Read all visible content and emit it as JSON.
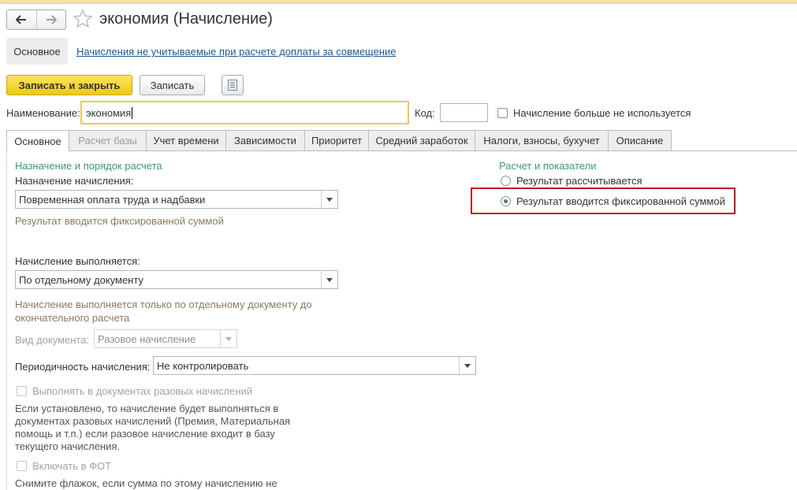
{
  "header": {
    "title": "экономия (Начисление)",
    "back_icon": "arrow-left-icon",
    "forward_icon": "arrow-right-icon",
    "favorite_icon": "star-icon"
  },
  "panel": {
    "main_label": "Основное",
    "link_text": "Начисления не учитываемые при расчете доплаты за совмещение"
  },
  "toolbar": {
    "save_close_label": "Записать и закрыть",
    "save_label": "Записать",
    "list_icon": "list-icon"
  },
  "form": {
    "name_label": "Наименование:",
    "name_value": "экономия",
    "code_label": "Код:",
    "code_value": "",
    "not_used_label": "Начисление больше не используется",
    "not_used_checked": false
  },
  "tabs": [
    {
      "label": "Основное",
      "state": "active"
    },
    {
      "label": "Расчет базы",
      "state": "disabled"
    },
    {
      "label": "Учет времени",
      "state": "normal"
    },
    {
      "label": "Зависимости",
      "state": "normal"
    },
    {
      "label": "Приоритет",
      "state": "normal"
    },
    {
      "label": "Средний заработок",
      "state": "normal"
    },
    {
      "label": "Налоги, взносы, бухучет",
      "state": "normal"
    },
    {
      "label": "Описание",
      "state": "normal"
    }
  ],
  "left": {
    "section_title": "Назначение и порядок расчета",
    "purpose_label": "Назначение начисления:",
    "purpose_value": "Повременная оплата труда и надбавки",
    "purpose_hint": "Результат вводится фиксированной суммой",
    "execution_label": "Начисление выполняется:",
    "execution_value": "По отдельному документу",
    "execution_hint": "Начисление выполняется только по отдельному документу до окончательного расчета",
    "doc_type_label": "Вид документа:",
    "doc_type_value": "Разовое начисление",
    "periodicity_label": "Периодичность начисления:",
    "periodicity_value": "Не контролировать",
    "one_time_label": "Выполнять в документах разовых начислений",
    "one_time_hint": "Если установлено, то начисление будет выполняться в документах разовых начислений (Премия, Материальная помощь и т.п.) если разовое начисление входит в базу текущего начисления.",
    "fot_label": "Включать в ФОТ",
    "fot_hint": "Снимите флажок, если сумма по этому начислению не"
  },
  "right": {
    "section_title": "Расчет и показатели",
    "radio_calculated": "Результат рассчитывается",
    "radio_fixed": "Результат вводится фиксированной суммой",
    "selected": "fixed",
    "highlight_color": "#c0161d"
  },
  "colors": {
    "accent_yellow": "#f0c812",
    "section_green": "#3d9970",
    "link_blue": "#1a5a95"
  }
}
